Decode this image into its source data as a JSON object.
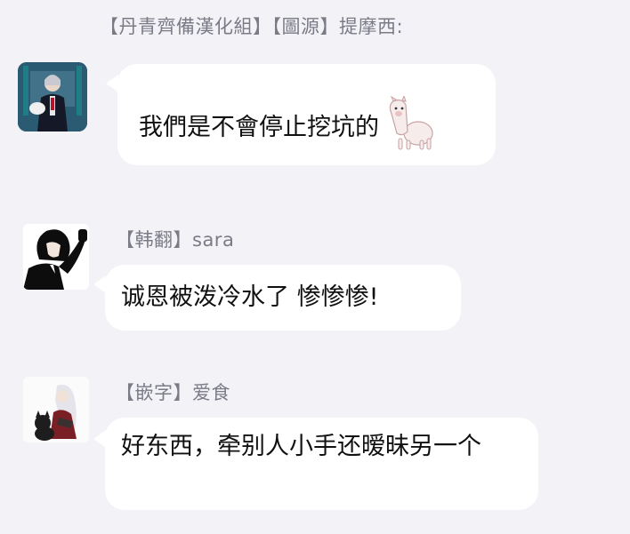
{
  "messages": [
    {
      "sender": "【丹青齊備漢化組】【圖源】提摩西:",
      "text": "我們是不會停止挖坑的",
      "emoji": "alpaca-sticker"
    },
    {
      "sender": "【韩翻】sara",
      "text": "诚恩被泼冷水了 惨惨惨!"
    },
    {
      "sender": "【嵌字】爱食",
      "text": "好东西，牵别人小手还暧昧另一个"
    }
  ],
  "colors": {
    "background": "#f2f2f7",
    "bubble": "#ffffff",
    "sender_text": "#7b7b86",
    "message_text": "#111111"
  }
}
